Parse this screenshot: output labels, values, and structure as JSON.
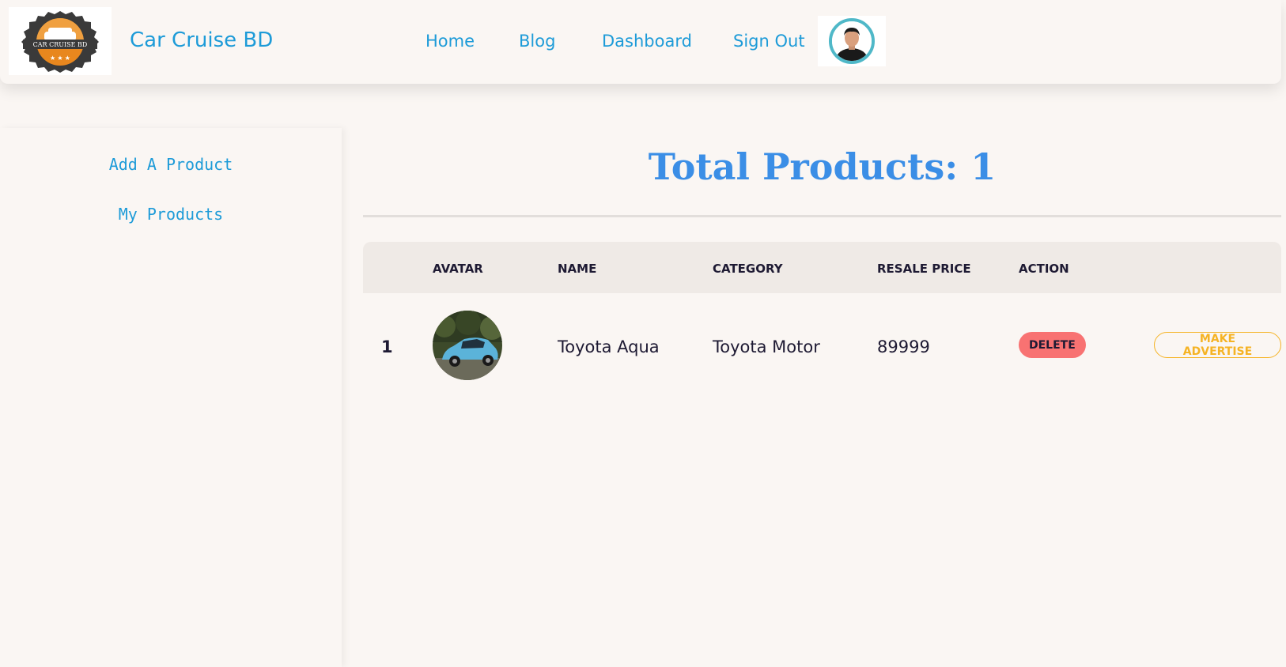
{
  "navbar": {
    "logo_alt": "Car Cruise BD",
    "logo_text": "CAR CRUISE BD",
    "brand": "Car Cruise BD",
    "links": [
      {
        "label": "Home"
      },
      {
        "label": "Blog"
      },
      {
        "label": "Dashboard"
      },
      {
        "label": "Sign Out"
      }
    ],
    "avatar_icon": "user-avatar"
  },
  "sidebar": {
    "items": [
      {
        "label": "Add A Product"
      },
      {
        "label": "My Products"
      }
    ]
  },
  "main": {
    "title": "Total Products: 1",
    "table": {
      "headers": [
        "",
        "AVATAR",
        "NAME",
        "CATEGORY",
        "RESALE PRICE",
        "ACTION"
      ],
      "rows": [
        {
          "index": "1",
          "avatar_icon": "car-photo",
          "name": "Toyota Aqua",
          "category": "Toyota Motor",
          "resale_price": "89999",
          "delete_label": "DELETE",
          "advertise_label": "MAKE ADVERTISE"
        }
      ]
    }
  },
  "colors": {
    "accent": "#1d9bd8",
    "title": "#3b8ee6",
    "delete": "#f87272",
    "advertise": "#f5b324",
    "background": "#faf6f3"
  }
}
